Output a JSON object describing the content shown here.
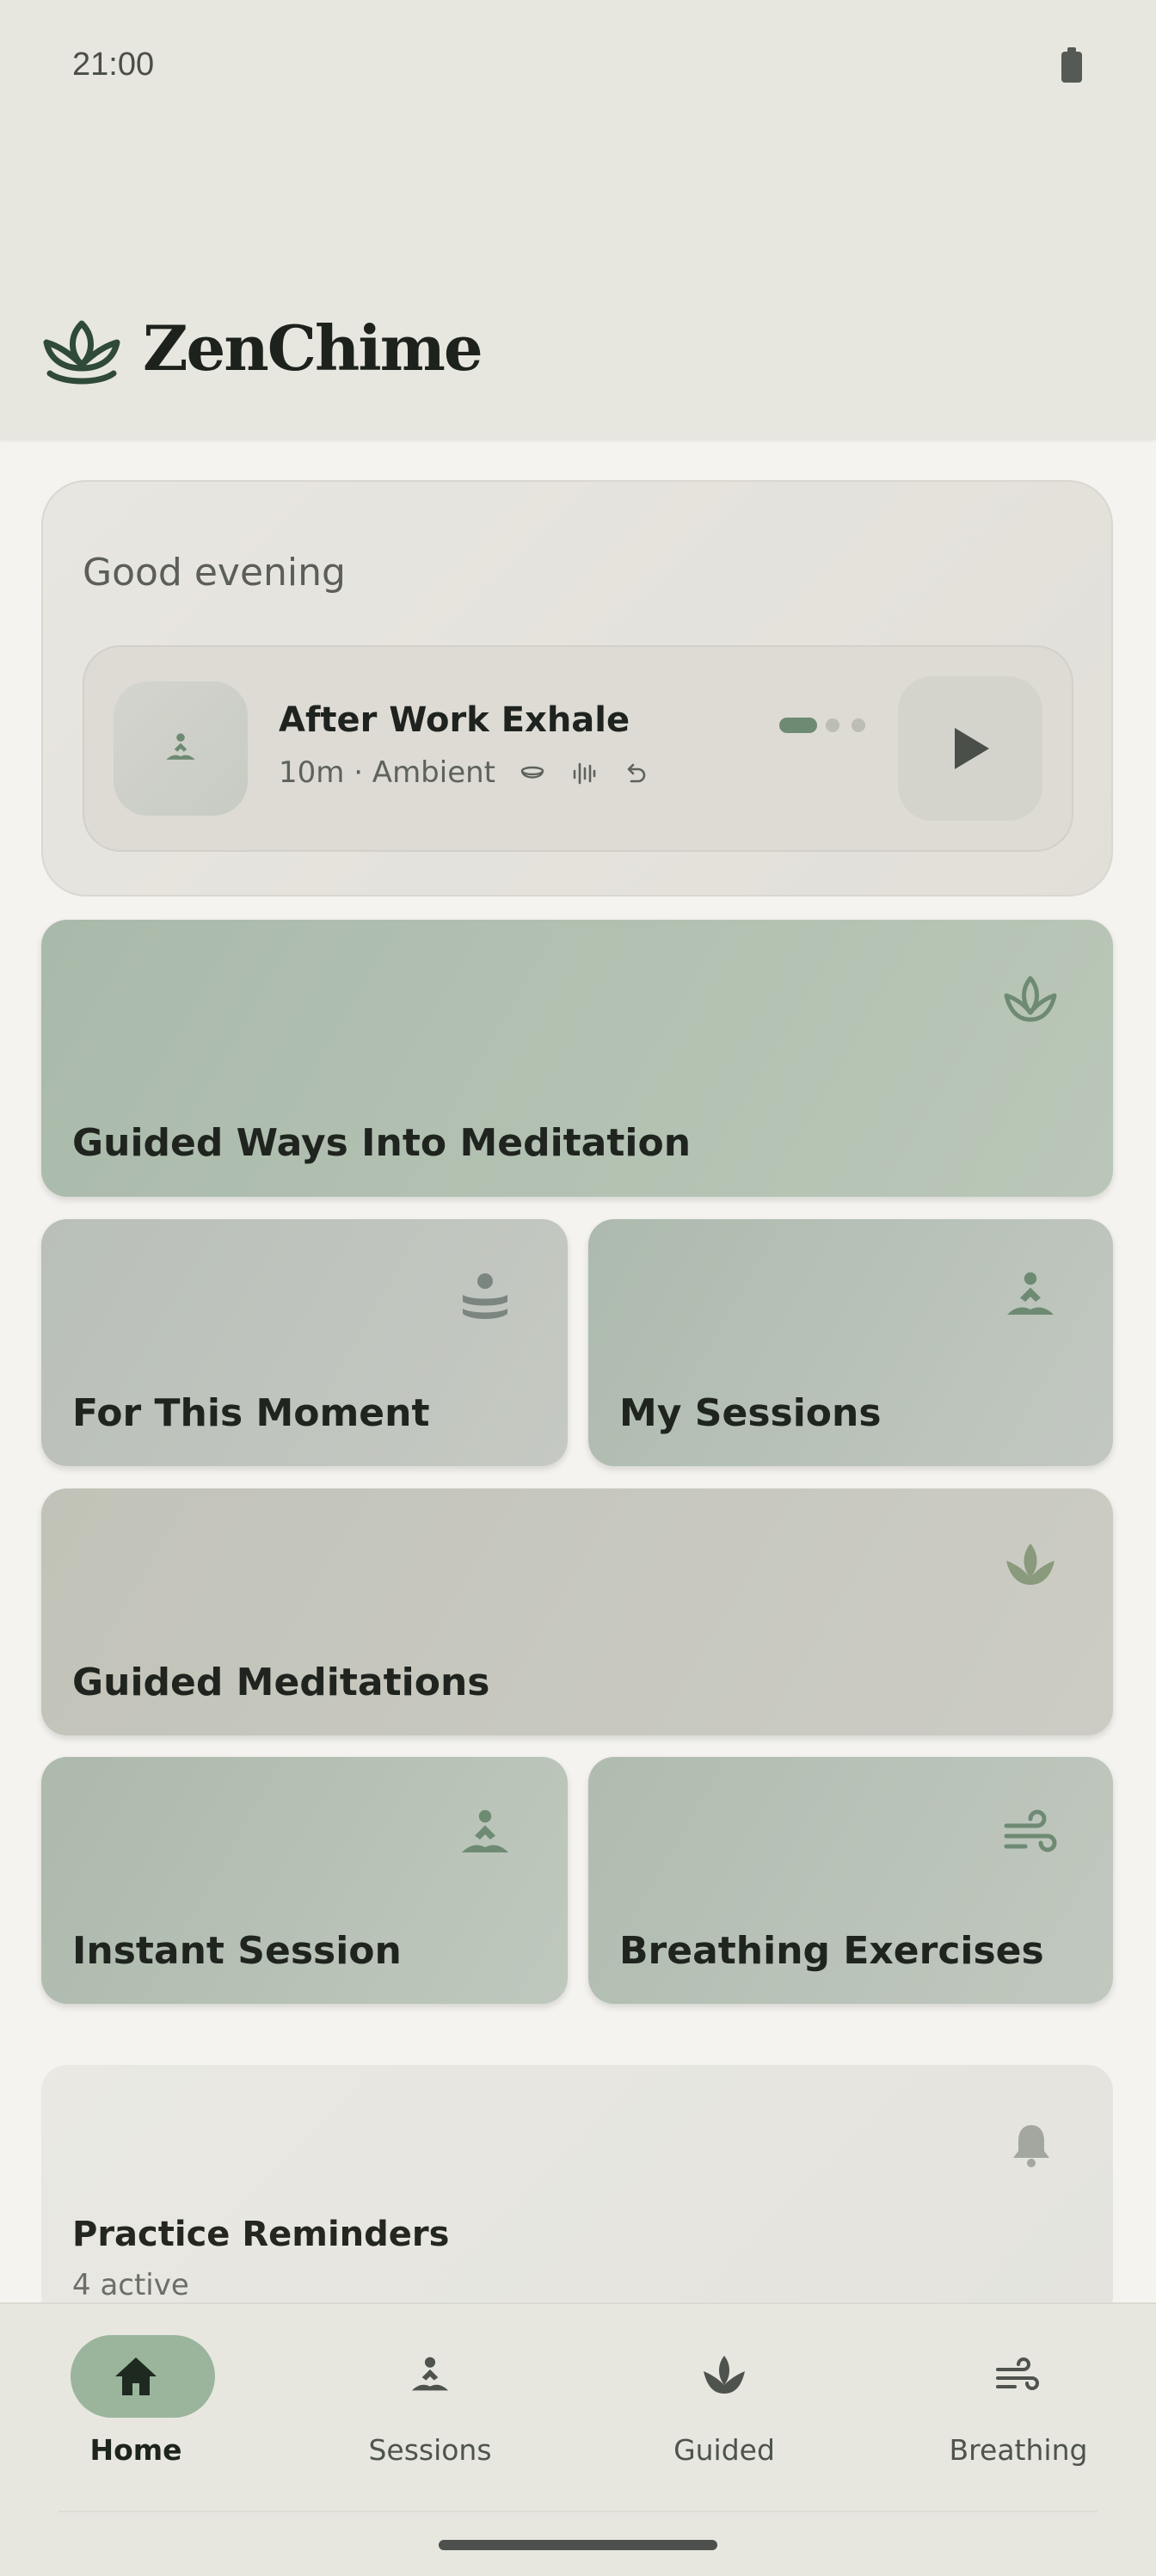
{
  "status_bar": {
    "time": "21:00",
    "battery_icon": "battery-icon"
  },
  "header": {
    "app_title": "ZenChime",
    "logo_icon": "lotus-icon"
  },
  "greeting_card": {
    "greeting": "Good evening",
    "now_playing": {
      "title": "After Work Exhale",
      "subtitle": "10m · Ambient",
      "thumbnail_icon": "meditation-icon",
      "feature_icons": [
        "singing-bowl-icon",
        "waveform-icon",
        "repeat-icon"
      ],
      "page_indicator": {
        "count": 3,
        "active": 1
      },
      "play_icon": "play-icon"
    }
  },
  "tiles": [
    {
      "id": "guided-ways",
      "label": "Guided Ways Into Meditation",
      "icon": "lotus-outline-icon"
    },
    {
      "id": "for-this-moment",
      "label": "For This Moment",
      "icon": "calm-person-icon"
    },
    {
      "id": "my-sessions",
      "label": "My Sessions",
      "icon": "meditation-icon"
    },
    {
      "id": "guided-meditations",
      "label": "Guided Meditations",
      "icon": "lotus-icon"
    },
    {
      "id": "instant-session",
      "label": "Instant Session",
      "icon": "meditation-icon"
    },
    {
      "id": "breathing-exercises",
      "label": "Breathing Exercises",
      "icon": "wind-icon"
    }
  ],
  "reminders": {
    "title": "Practice Reminders",
    "subtitle": "4 active",
    "icon": "bell-icon"
  },
  "bottom_nav": {
    "items": [
      {
        "label": "Home",
        "icon": "home-icon",
        "active": true
      },
      {
        "label": "Sessions",
        "icon": "meditation-icon",
        "active": false
      },
      {
        "label": "Guided",
        "icon": "lotus-icon",
        "active": false
      },
      {
        "label": "Breathing",
        "icon": "wind-icon",
        "active": false
      }
    ]
  },
  "colors": {
    "background": "#f4f3ef",
    "header_bg": "#e7e7e0",
    "accent_green": "#6e8a73",
    "nav_active_pill": "#9bb59d"
  }
}
